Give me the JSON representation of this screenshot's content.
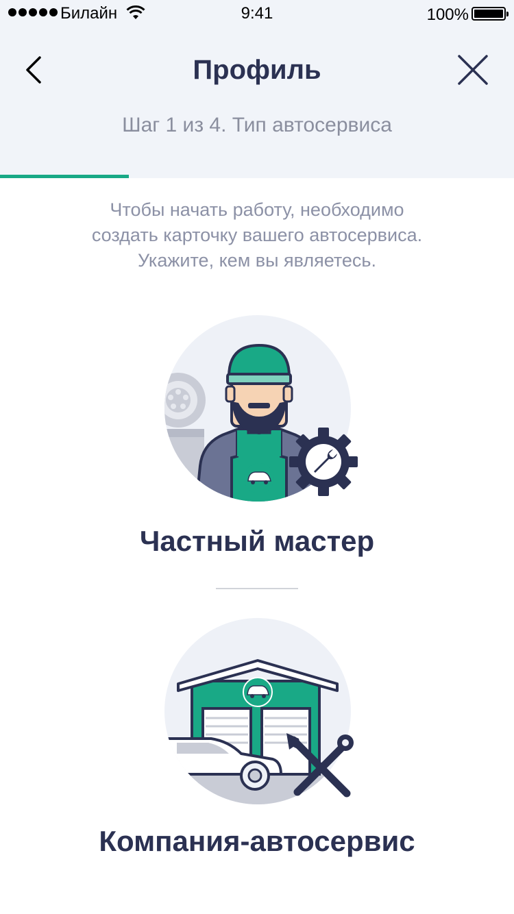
{
  "status_bar": {
    "carrier": "Билайн",
    "time": "9:41",
    "battery": "100%"
  },
  "nav": {
    "title": "Профиль",
    "subtitle": "Шаг 1 из 4. Тип автосервиса",
    "back_icon": "chevron-left-icon",
    "close_icon": "close-icon"
  },
  "progress": {
    "step": 1,
    "total": 4,
    "fraction": 0.25,
    "color": "#19a986"
  },
  "intro": {
    "line1": "Чтобы начать работу, необходимо",
    "line2": "создать карточку вашего автосервиса.",
    "line3": "Укажите, кем вы являетесь."
  },
  "options": [
    {
      "label": "Частный мастер",
      "icon": "mechanic-icon"
    },
    {
      "label": "Компания-автосервис",
      "icon": "garage-icon"
    }
  ],
  "colors": {
    "accent": "#19a986",
    "header_bg": "#f1f4f9",
    "dark": "#2b3152",
    "muted": "#8c91a6"
  }
}
